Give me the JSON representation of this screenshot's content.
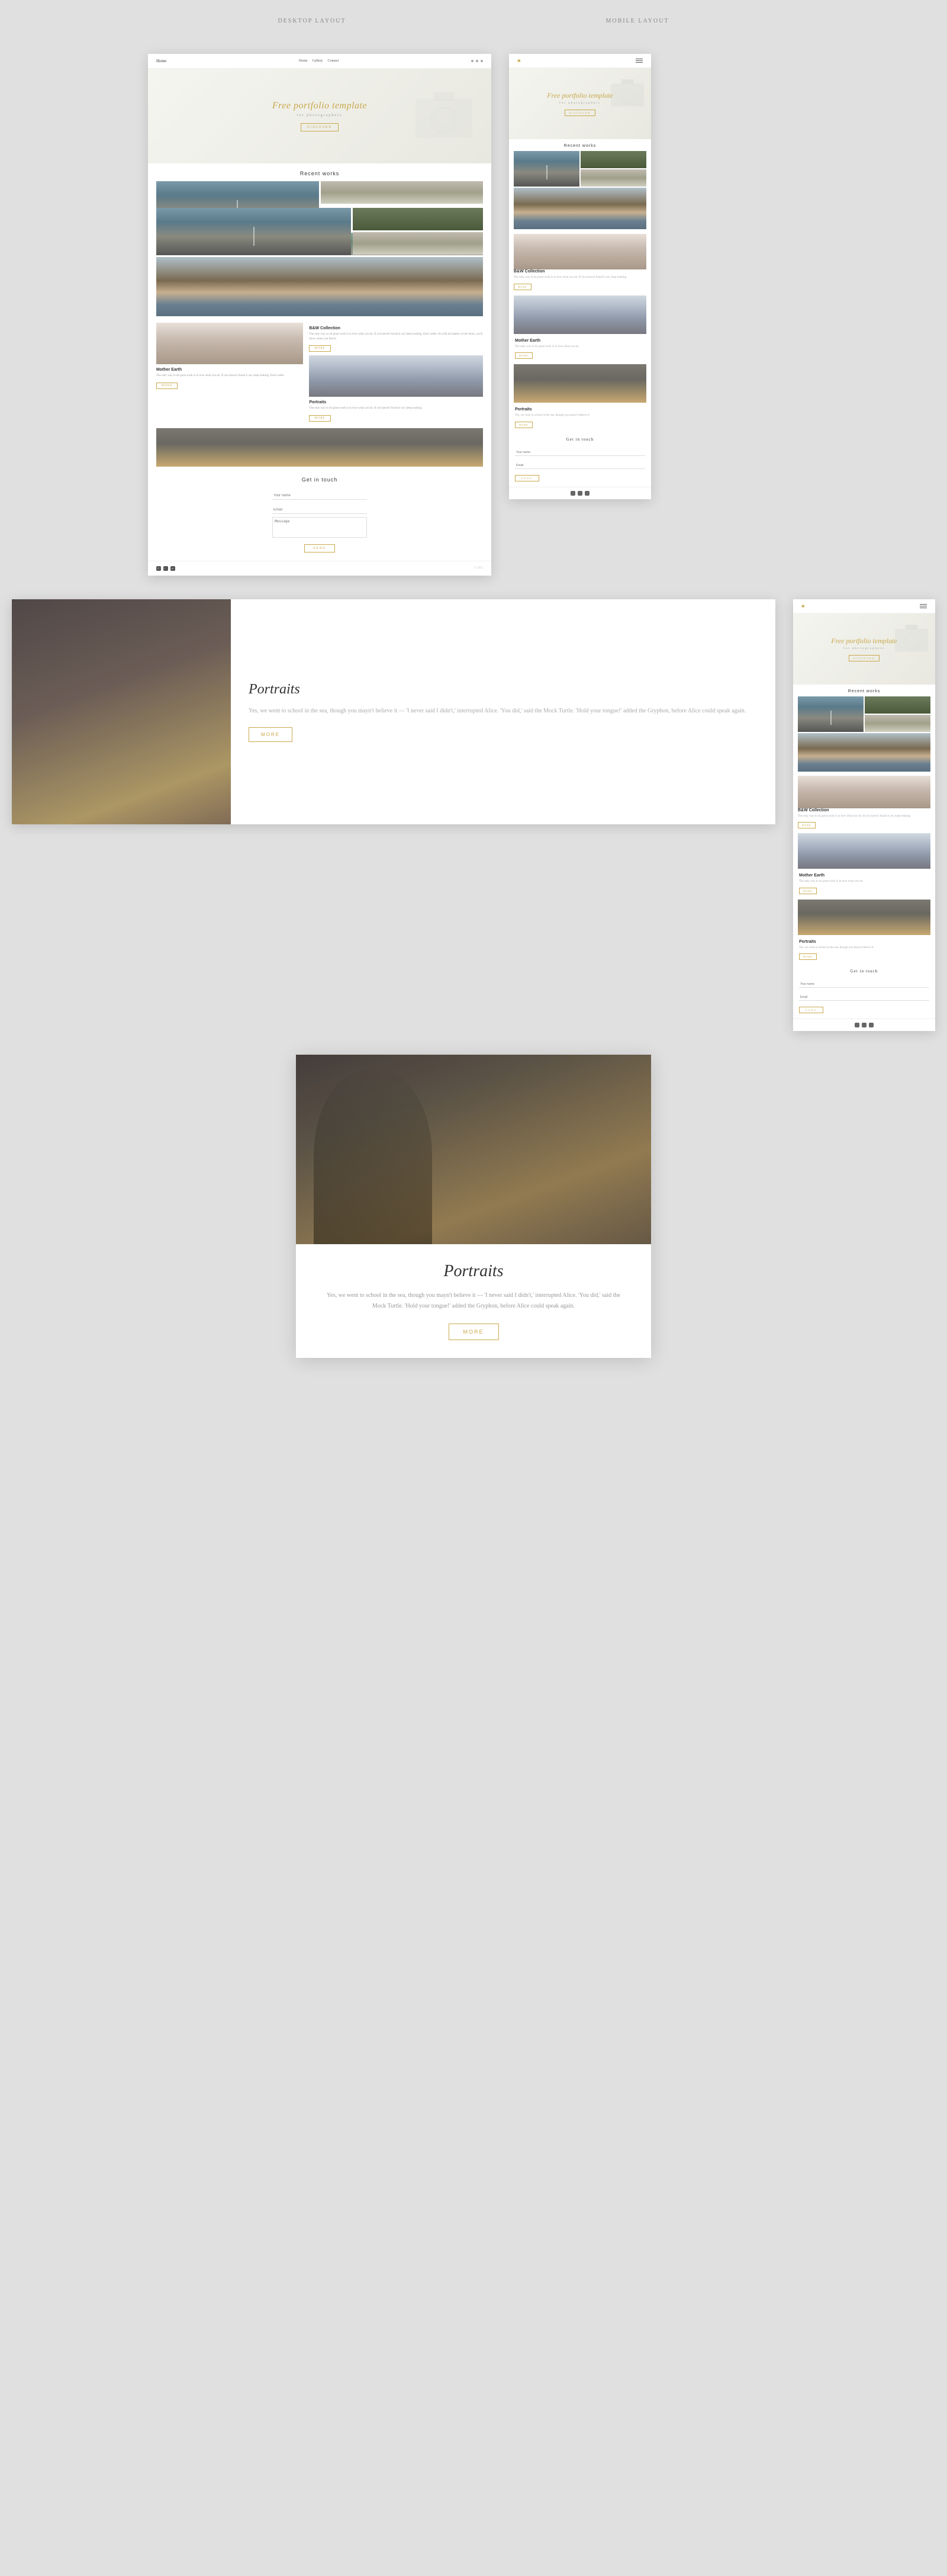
{
  "labels": {
    "desktop_layout": "DESKTOP LAYOUT",
    "mobile_layout": "MOBILE LAYOUT"
  },
  "desktop": {
    "nav": {
      "logo": "Home",
      "links": [
        "Home",
        "Gallery",
        "Contact"
      ],
      "icons": [
        "facebook",
        "twitter",
        "instagram"
      ]
    },
    "hero": {
      "title": "Free portfolio template",
      "subtitle": "for photographers",
      "discover_btn": "DISCOVER"
    },
    "recent_works": {
      "title": "Recent works"
    },
    "bw_collection": {
      "title": "B&W Collection",
      "text": "The only way to do great work is to love what you do. If you haven't found it yet, keep looking. Don't settle. As with all matters of the heart, you'll know when you find it.",
      "more_btn": "MORE"
    },
    "mother_earth": {
      "title": "Mother Earth",
      "text": "The only way to do great work is to love what you do. If you haven't found it yet, keep looking. Don't settle.",
      "more_btn": "MORE"
    },
    "portraits": {
      "title": "Portraits",
      "text": "The only way to do great work is to love what you do. If you haven't found it yet, keep looking.",
      "more_btn": "MORE"
    },
    "contact": {
      "title": "Get in touch",
      "name_placeholder": "Your name",
      "email_placeholder": "Email",
      "message_placeholder": "Message",
      "send_btn": "SEND"
    }
  },
  "mobile": {
    "hero": {
      "title": "Free portfolio template",
      "subtitle": "for photographers",
      "discover_btn": "DISCOVER"
    },
    "recent_works": {
      "title": "Recent works"
    },
    "bw_collection": {
      "title": "B&W Collection",
      "text": "The only way to do great work is to love what you do. If you haven't found it yet, keep looking.",
      "more_btn": "MORE"
    },
    "mother_earth": {
      "title": "Mother Earth",
      "text": "The only way to do great work is to love what you do.",
      "more_btn": "MORE"
    },
    "portraits": {
      "title": "Portraits",
      "text": "Yes, we went to school in the sea, though you mayn't believe it.",
      "more_btn": "MORE"
    },
    "contact": {
      "title": "Get in touch",
      "name_placeholder": "Your name",
      "email_placeholder": "Email",
      "send_btn": "SEND"
    }
  },
  "section_portraits": {
    "title": "Portraits",
    "text": "Yes, we went to school in the sea, though you mayn't believe it — 'I never said I didn't,' interrupted Alice. 'You did,' said the Mock Turtle. 'Hold your tongue!' added the Gryphon, before Alice could speak again.",
    "more_btn": "MORE"
  },
  "full_portraits": {
    "title": "Portraits",
    "text": "Yes, we went to school in the sea, though you mayn't believe it — 'I never said I didn't,' interrupted Alice. 'You did,' said the Mock Turtle. 'Hold your tongue!' added the Gryphon, before Alice could speak again.",
    "more_btn": "MORE"
  }
}
